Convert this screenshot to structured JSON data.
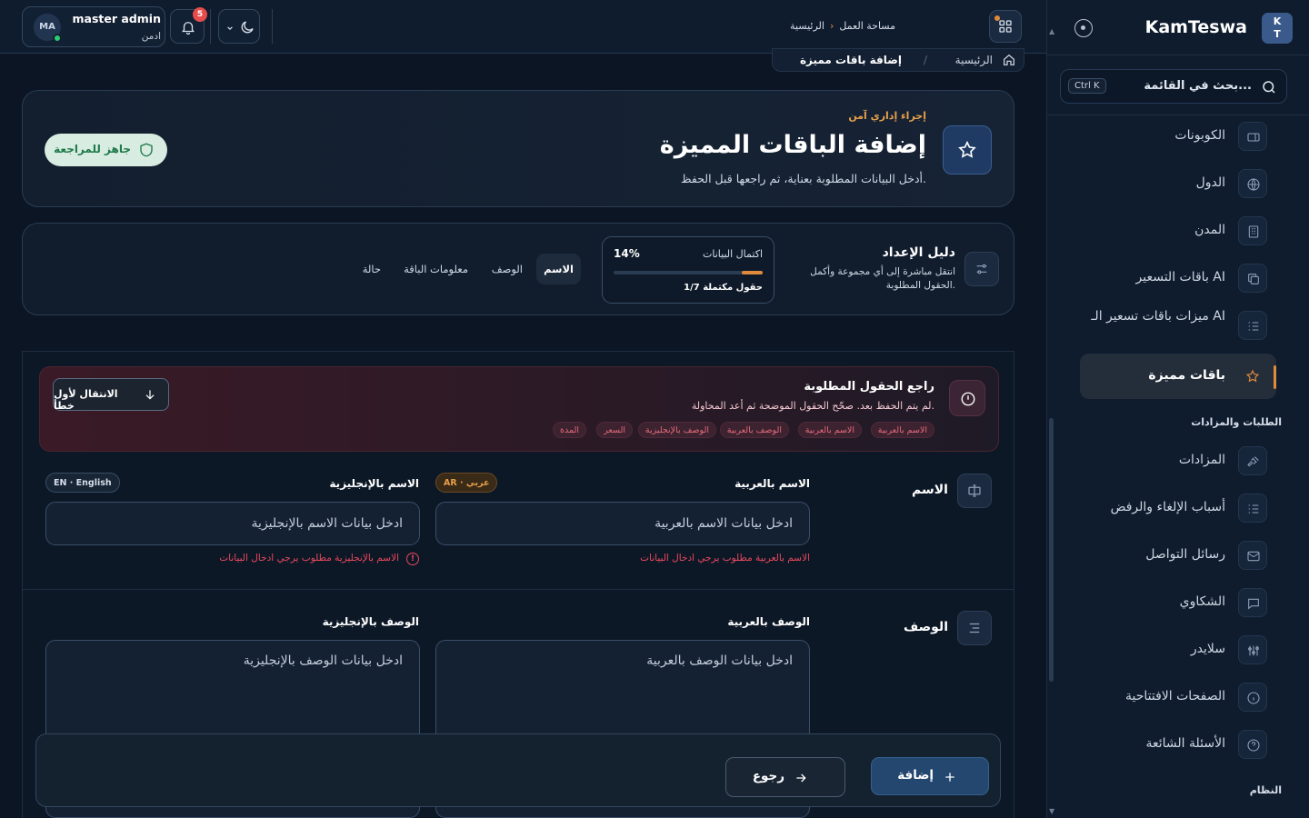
{
  "brand": {
    "name": "KamTeswa",
    "logo_line1": "K",
    "logo_line2": "T"
  },
  "search": {
    "placeholder": "بحث في القائمة...",
    "shortcut": "Ctrl K"
  },
  "sidebar": {
    "items": [
      {
        "label": "الكوبونات",
        "icon": "ticket-icon"
      },
      {
        "label": "الدول",
        "icon": "globe-icon"
      },
      {
        "label": "المدن",
        "icon": "building-icon"
      },
      {
        "label": "باقات التسعير AI",
        "icon": "copy-icon"
      },
      {
        "label": "ميزات باقات تسعير الـ AI",
        "icon": "list-check-icon"
      },
      {
        "label": "باقات مميزة",
        "icon": "star-icon",
        "active": true
      }
    ],
    "section_orders": "الطلبات والمزادات",
    "items2": [
      {
        "label": "المزادات",
        "icon": "gavel-icon"
      },
      {
        "label": "أسباب الإلغاء والرفض",
        "icon": "list-check-icon"
      },
      {
        "label": "رسائل التواصل",
        "icon": "mail-icon"
      },
      {
        "label": "الشكاوي",
        "icon": "message-icon"
      },
      {
        "label": "سلايدر",
        "icon": "sliders-icon"
      },
      {
        "label": "الصفحات الافتتاحية",
        "icon": "info-icon"
      },
      {
        "label": "الأسئلة الشائعة",
        "icon": "help-icon"
      }
    ],
    "section_system": "النظام"
  },
  "header": {
    "user_name": "master admin",
    "user_role": "ادمن",
    "avatar_initials": "MA",
    "notifications_count": "5",
    "breadcrumb_home": "الرئيسية",
    "breadcrumb_workspace": "مساحة العمل"
  },
  "page": {
    "crumb_home": "الرئيسية",
    "crumb_current": "إضافة باقات مميزة",
    "kicker": "إجراء إداري آمن",
    "title": "إضافة الباقات المميزة",
    "subtitle": "أدخل البيانات المطلوبة بعناية، ثم راجعها قبل الحفظ.",
    "ready_label": "جاهز للمراجعة"
  },
  "guide": {
    "title": "دليل الإعداد",
    "desc": "انتقل مباشرة إلى أي مجموعة وأكمل الحقول المطلوبة.",
    "progress_label": "اكتمال البيانات",
    "progress_percent": "14%",
    "progress_value": 0.14,
    "progress_count": "1/7 حقول مكتملة",
    "tabs": [
      "الاسم",
      "الوصف",
      "معلومات الباقة",
      "حالة"
    ]
  },
  "alert": {
    "title": "راجع الحقول المطلوبة",
    "subtitle": "لم يتم الحفظ بعد. صحّح الحقول الموضحة ثم أعد المحاولة.",
    "chips": [
      "الاسم بالعربية",
      "الاسم بالعربية",
      "الوصف بالعربية",
      "الوصف بالإنجليزية",
      "السعر",
      "المدة"
    ],
    "jump_label": "الانتقال لأول خطأ"
  },
  "form": {
    "name_section": "الاسم",
    "name_ar_label": "الاسم بالعربية",
    "name_ar_lang": "AR · عربي",
    "name_ar_placeholder": "ادخل بيانات الاسم بالعربية",
    "name_ar_error": "الاسم بالعربية مطلوب يرجي ادخال البيانات",
    "name_en_label": "الاسم بالإنجليزية",
    "name_en_lang": "EN · English",
    "name_en_placeholder": "ادخل بيانات الاسم بالإنجليزية",
    "name_en_error": "الاسم بالإنجليزية مطلوب يرجي ادخال البيانات",
    "desc_section": "الوصف",
    "desc_ar_label": "الوصف بالعربية",
    "desc_ar_placeholder": "ادخل بيانات الوصف بالعربية",
    "desc_en_label": "الوصف بالإنجليزية",
    "desc_en_placeholder": "ادخل بيانات الوصف بالإنجليزية"
  },
  "actions": {
    "add_label": "إضافة",
    "back_label": "رجوع"
  }
}
